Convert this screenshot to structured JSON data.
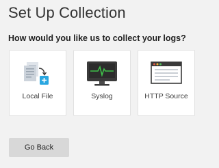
{
  "header": {
    "title": "Set Up Collection"
  },
  "question": "How would you like us to collect your logs?",
  "sources": [
    {
      "label": "Local File",
      "icon": "local-file-icon"
    },
    {
      "label": "Syslog",
      "icon": "syslog-monitor-icon"
    },
    {
      "label": "HTTP Source",
      "icon": "browser-window-icon"
    }
  ],
  "footer": {
    "back_label": "Go Back"
  },
  "colors": {
    "accent_blue": "#29a6e0",
    "pulse_green": "#3fc14a",
    "monitor_dark": "#3a3a3a",
    "window_red": "#e05a47",
    "window_yellow": "#f5b335",
    "window_green": "#4fbf5a"
  }
}
